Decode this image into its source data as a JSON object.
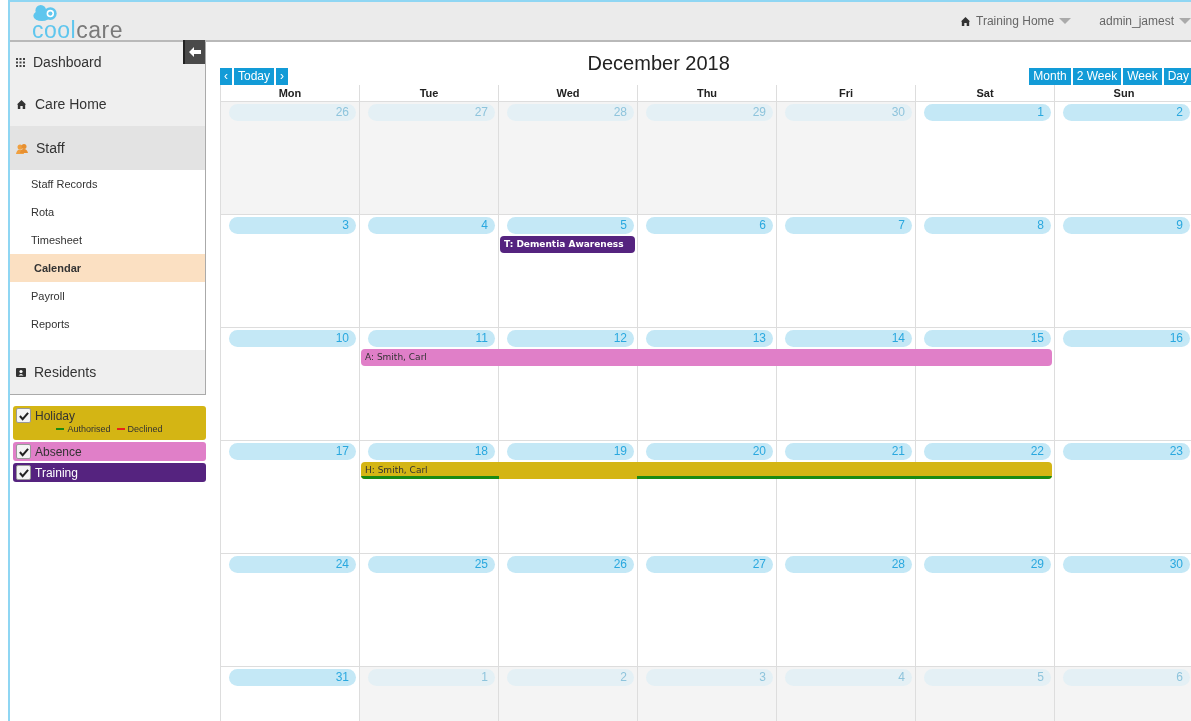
{
  "header": {
    "logo": {
      "first": "cool",
      "second": "care"
    },
    "home_menu": "Training Home",
    "user_menu": "admin_jamest"
  },
  "sidebar": {
    "items": [
      {
        "label": "Dashboard",
        "expanded": false
      },
      {
        "label": "Care Home",
        "expanded": false
      },
      {
        "label": "Staff",
        "expanded": true,
        "children": [
          {
            "label": "Staff Records",
            "selected": false
          },
          {
            "label": "Rota",
            "selected": false
          },
          {
            "label": "Timesheet",
            "selected": false
          },
          {
            "label": "Calendar",
            "selected": true
          },
          {
            "label": "Payroll",
            "selected": false
          },
          {
            "label": "Reports",
            "selected": false
          }
        ]
      },
      {
        "label": "Residents",
        "expanded": false
      }
    ]
  },
  "legend": [
    {
      "label": "Holiday",
      "checked": true,
      "color": "#d4b514",
      "notes": [
        {
          "label": "Authorised",
          "color": "#1b8a12"
        },
        {
          "label": "Declined",
          "color": "#e8231b"
        }
      ]
    },
    {
      "label": "Absence",
      "checked": true,
      "color": "#e07fc8"
    },
    {
      "label": "Training",
      "checked": true,
      "color": "#55237f"
    }
  ],
  "calendar": {
    "title": "December 2018",
    "nav": [
      "‹",
      "Today",
      "›"
    ],
    "views": [
      "Month",
      "2 Week",
      "Week",
      "Day"
    ],
    "weekdays": [
      "Mon",
      "Tue",
      "Wed",
      "Thu",
      "Fri",
      "Sat",
      "Sun"
    ],
    "weeks": [
      {
        "days": [
          {
            "label": "26",
            "other_month": true
          },
          {
            "label": "27",
            "other_month": true
          },
          {
            "label": "28",
            "other_month": true
          },
          {
            "label": "29",
            "other_month": true
          },
          {
            "label": "30",
            "other_month": true
          },
          {
            "label": "1",
            "other_month": false
          },
          {
            "label": "2",
            "other_month": false
          }
        ]
      },
      {
        "days": [
          {
            "label": "3",
            "other_month": false
          },
          {
            "label": "4",
            "other_month": false
          },
          {
            "label": "5",
            "other_month": false,
            "events": [
              {
                "label": "T: Dementia Awareness",
                "color": "#55237f",
                "segments": [
                  {
                    "authorised": false
                  }
                ]
              }
            ]
          },
          {
            "label": "6",
            "other_month": false
          },
          {
            "label": "7",
            "other_month": false
          },
          {
            "label": "8",
            "other_month": false
          },
          {
            "label": "9",
            "other_month": false
          }
        ]
      },
      {
        "days": [
          {
            "label": "10",
            "other_month": false
          },
          {
            "label": "11",
            "other_month": false,
            "events": [
              {
                "label": "A: Smith, Carl",
                "color": "#e07fc8",
                "segments": [
                  {
                    "authorised": false
                  },
                  {
                    "authorised": false
                  },
                  {
                    "authorised": false
                  },
                  {
                    "authorised": false
                  },
                  {
                    "authorised": false
                  }
                ]
              }
            ]
          },
          {
            "label": "12",
            "other_month": false
          },
          {
            "label": "13",
            "other_month": false
          },
          {
            "label": "14",
            "other_month": false
          },
          {
            "label": "15",
            "other_month": false
          },
          {
            "label": "16",
            "other_month": false
          }
        ]
      },
      {
        "days": [
          {
            "label": "17",
            "other_month": false
          },
          {
            "label": "18",
            "other_month": false,
            "events": [
              {
                "label": "H: Smith, Carl",
                "color": "#d4b514",
                "segments": [
                  {
                    "authorised": true
                  },
                  {
                    "authorised": false
                  },
                  {
                    "authorised": true
                  },
                  {
                    "authorised": true
                  },
                  {
                    "authorised": true
                  }
                ]
              }
            ]
          },
          {
            "label": "19",
            "other_month": false
          },
          {
            "label": "20",
            "other_month": false
          },
          {
            "label": "21",
            "other_month": false
          },
          {
            "label": "22",
            "other_month": false
          },
          {
            "label": "23",
            "other_month": false
          }
        ]
      },
      {
        "days": [
          {
            "label": "24",
            "other_month": false
          },
          {
            "label": "25",
            "other_month": false
          },
          {
            "label": "26",
            "other_month": false
          },
          {
            "label": "27",
            "other_month": false
          },
          {
            "label": "28",
            "other_month": false
          },
          {
            "label": "29",
            "other_month": false
          },
          {
            "label": "30",
            "other_month": false
          }
        ]
      },
      {
        "days": [
          {
            "label": "31",
            "other_month": false
          },
          {
            "label": "1",
            "other_month": true
          },
          {
            "label": "2",
            "other_month": true
          },
          {
            "label": "3",
            "other_month": true
          },
          {
            "label": "4",
            "other_month": true
          },
          {
            "label": "5",
            "other_month": true
          },
          {
            "label": "6",
            "other_month": true
          }
        ]
      }
    ]
  }
}
